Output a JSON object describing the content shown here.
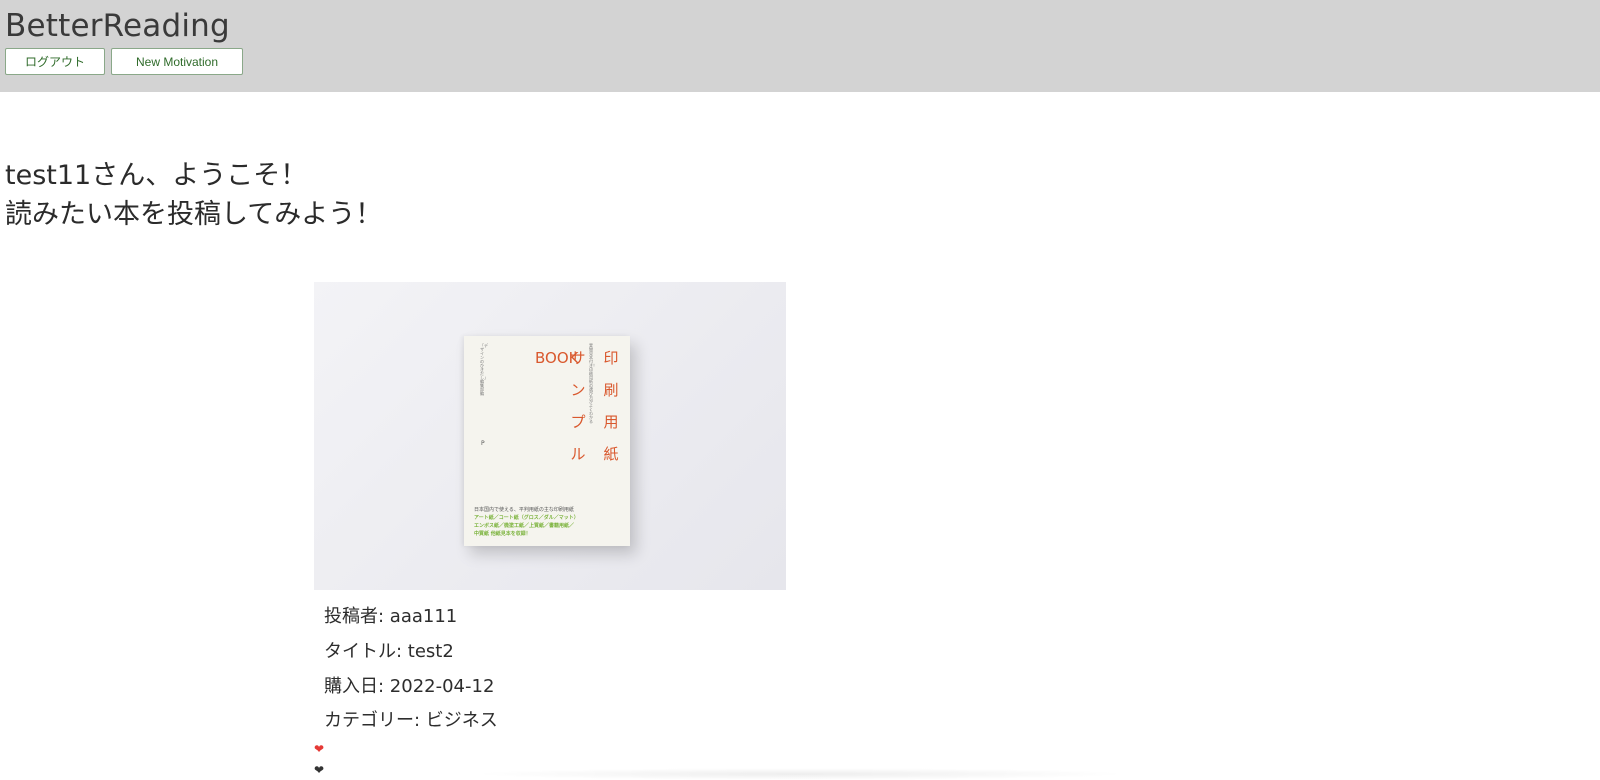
{
  "header": {
    "brand": "BetterReading",
    "logout_label": "ログアウト",
    "motivation_label": "New Motivation"
  },
  "welcome": {
    "line1": "test11さん、ようこそ！",
    "line2": "読みたい本を投稿してみよう！"
  },
  "post": {
    "poster": "投稿者: aaa111",
    "title": "タイトル: test2",
    "purchase_date": "購入日: 2022-04-12",
    "category": "カテゴリー: ビジネス",
    "like_icon": "heart-icon",
    "unlike_icon": "heart-icon",
    "cover": {
      "title_col1": "印刷用紙",
      "title_col2": "サンプル",
      "title_col3": "BOOK",
      "subtitle": "実物見本付き！印刷用紙の選び方がよくわかる",
      "author": "「デザインのひきだし」編集部 編",
      "publisher_mark": "P",
      "foot_line1": "日本国内で使える、平判用紙の主な印刷用紙",
      "foot_line2": "アート紙／コート紙（グロス／ダル／マット）",
      "foot_line3": "エンボス紙／微塗工紙／上質紙／書籍用紙／",
      "foot_line4": "中質紙 他紙見本を収録！"
    }
  },
  "colors": {
    "header_bg": "#d3d3d3",
    "button_text": "#2f6b2a",
    "heart_liked": "#e53935",
    "heart_default": "#333333",
    "cover_title": "#d9582d"
  }
}
